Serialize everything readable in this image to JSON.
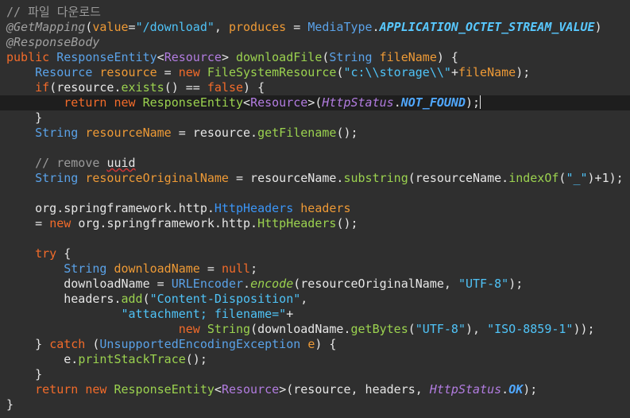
{
  "editor": {
    "lines": [
      [
        {
          "t": "// 파일 다운로드",
          "c": "cm"
        }
      ],
      [
        {
          "t": "@GetMapping",
          "c": "an"
        },
        {
          "t": "(",
          "c": "pl"
        },
        {
          "t": "value",
          "c": "pr"
        },
        {
          "t": "=",
          "c": "pl"
        },
        {
          "t": "\"/download\"",
          "c": "st"
        },
        {
          "t": ", ",
          "c": "pl"
        },
        {
          "t": "produces",
          "c": "pr"
        },
        {
          "t": " = ",
          "c": "pl"
        },
        {
          "t": "MediaType",
          "c": "ty"
        },
        {
          "t": ".",
          "c": "pl"
        },
        {
          "t": "APPLICATION_OCTET_STREAM_VALUE",
          "c": "cb"
        },
        {
          "t": ")",
          "c": "pl"
        }
      ],
      [
        {
          "t": "@ResponseBody",
          "c": "an"
        }
      ],
      [
        {
          "t": "public ",
          "c": "kw"
        },
        {
          "t": "ResponseEntity",
          "c": "ty"
        },
        {
          "t": "<",
          "c": "pl"
        },
        {
          "t": "Resource",
          "c": "ge"
        },
        {
          "t": "> ",
          "c": "pl"
        },
        {
          "t": "downloadFile",
          "c": "mt"
        },
        {
          "t": "(",
          "c": "pl"
        },
        {
          "t": "String ",
          "c": "ty"
        },
        {
          "t": "fileName",
          "c": "pr"
        },
        {
          "t": ") {",
          "c": "pl"
        }
      ],
      [
        {
          "t": "    ",
          "c": "pl"
        },
        {
          "t": "Resource ",
          "c": "ty"
        },
        {
          "t": "resource",
          "c": "pr"
        },
        {
          "t": " = ",
          "c": "pl"
        },
        {
          "t": "new ",
          "c": "kw"
        },
        {
          "t": "FileSystemResource",
          "c": "gn"
        },
        {
          "t": "(",
          "c": "pl"
        },
        {
          "t": "\"c:\\\\storage\\\\\"",
          "c": "st"
        },
        {
          "t": "+",
          "c": "pl"
        },
        {
          "t": "fileName",
          "c": "pr"
        },
        {
          "t": ");",
          "c": "pl"
        }
      ],
      [
        {
          "t": "    ",
          "c": "pl"
        },
        {
          "t": "if",
          "c": "kw"
        },
        {
          "t": "(resource.",
          "c": "pl"
        },
        {
          "t": "exists",
          "c": "mt"
        },
        {
          "t": "() == ",
          "c": "pl"
        },
        {
          "t": "false",
          "c": "kw"
        },
        {
          "t": ") {",
          "c": "pl"
        }
      ],
      [
        {
          "t": "        ",
          "c": "pl"
        },
        {
          "t": "return ",
          "c": "kw"
        },
        {
          "t": "new ",
          "c": "kw"
        },
        {
          "t": "ResponseEntity",
          "c": "gn"
        },
        {
          "t": "<",
          "c": "pl"
        },
        {
          "t": "Resource",
          "c": "ge"
        },
        {
          "t": ">(",
          "c": "pl"
        },
        {
          "t": "HttpStatus",
          "c": "ic"
        },
        {
          "t": ".",
          "c": "pl"
        },
        {
          "t": "NOT_FOUND",
          "c": "cn"
        },
        {
          "t": ");",
          "c": "pl"
        }
      ],
      [
        {
          "t": "    }",
          "c": "pl"
        }
      ],
      [
        {
          "t": "    ",
          "c": "pl"
        },
        {
          "t": "String ",
          "c": "ty"
        },
        {
          "t": "resourceName",
          "c": "pr"
        },
        {
          "t": " = resource.",
          "c": "pl"
        },
        {
          "t": "getFilename",
          "c": "mt"
        },
        {
          "t": "();",
          "c": "pl"
        }
      ],
      [],
      [
        {
          "t": "    // remove ",
          "c": "cm"
        },
        {
          "t": "uuid",
          "c": "sq"
        }
      ],
      [
        {
          "t": "    ",
          "c": "pl"
        },
        {
          "t": "String ",
          "c": "ty"
        },
        {
          "t": "resourceOriginalName",
          "c": "pr"
        },
        {
          "t": " = resourceName.",
          "c": "pl"
        },
        {
          "t": "substring",
          "c": "mt"
        },
        {
          "t": "(resourceName.",
          "c": "pl"
        },
        {
          "t": "indexOf",
          "c": "mt"
        },
        {
          "t": "(",
          "c": "pl"
        },
        {
          "t": "\"_\"",
          "c": "st"
        },
        {
          "t": ")+1);",
          "c": "pl"
        }
      ],
      [],
      [
        {
          "t": "    org.springframework.http.",
          "c": "pl"
        },
        {
          "t": "HttpHeaders ",
          "c": "tb"
        },
        {
          "t": "headers",
          "c": "pr"
        }
      ],
      [
        {
          "t": "    = ",
          "c": "pl"
        },
        {
          "t": "new ",
          "c": "kw"
        },
        {
          "t": "org.springframework.http.",
          "c": "pl"
        },
        {
          "t": "HttpHeaders",
          "c": "gn"
        },
        {
          "t": "();",
          "c": "pl"
        }
      ],
      [],
      [
        {
          "t": "    ",
          "c": "pl"
        },
        {
          "t": "try",
          "c": "kw"
        },
        {
          "t": " {",
          "c": "pl"
        }
      ],
      [
        {
          "t": "        ",
          "c": "pl"
        },
        {
          "t": "String ",
          "c": "ty"
        },
        {
          "t": "downloadName",
          "c": "pr"
        },
        {
          "t": " = ",
          "c": "pl"
        },
        {
          "t": "null",
          "c": "kw"
        },
        {
          "t": ";",
          "c": "pl"
        }
      ],
      [
        {
          "t": "        downloadName = ",
          "c": "pl"
        },
        {
          "t": "URLEncoder",
          "c": "ty"
        },
        {
          "t": ".",
          "c": "pl"
        },
        {
          "t": "encode",
          "c": "mi"
        },
        {
          "t": "(resourceOriginalName, ",
          "c": "pl"
        },
        {
          "t": "\"UTF-8\"",
          "c": "st"
        },
        {
          "t": ");",
          "c": "pl"
        }
      ],
      [
        {
          "t": "        headers.",
          "c": "pl"
        },
        {
          "t": "add",
          "c": "mt"
        },
        {
          "t": "(",
          "c": "pl"
        },
        {
          "t": "\"Content-Disposition\"",
          "c": "st"
        },
        {
          "t": ",",
          "c": "pl"
        }
      ],
      [
        {
          "t": "                ",
          "c": "pl"
        },
        {
          "t": "\"attachment; filename=\"",
          "c": "st"
        },
        {
          "t": "+",
          "c": "pl"
        }
      ],
      [
        {
          "t": "                        ",
          "c": "pl"
        },
        {
          "t": "new ",
          "c": "kw"
        },
        {
          "t": "String",
          "c": "gn"
        },
        {
          "t": "(downloadName.",
          "c": "pl"
        },
        {
          "t": "getBytes",
          "c": "mt"
        },
        {
          "t": "(",
          "c": "pl"
        },
        {
          "t": "\"UTF-8\"",
          "c": "st"
        },
        {
          "t": "), ",
          "c": "pl"
        },
        {
          "t": "\"ISO-8859-1\"",
          "c": "st"
        },
        {
          "t": "));",
          "c": "pl"
        }
      ],
      [
        {
          "t": "    } ",
          "c": "pl"
        },
        {
          "t": "catch ",
          "c": "kw"
        },
        {
          "t": "(",
          "c": "pl"
        },
        {
          "t": "UnsupportedEncodingException ",
          "c": "ty"
        },
        {
          "t": "e",
          "c": "pr"
        },
        {
          "t": ") {",
          "c": "pl"
        }
      ],
      [
        {
          "t": "        e.",
          "c": "pl"
        },
        {
          "t": "printStackTrace",
          "c": "mt"
        },
        {
          "t": "();",
          "c": "pl"
        }
      ],
      [
        {
          "t": "    }",
          "c": "pl"
        }
      ],
      [
        {
          "t": "    ",
          "c": "pl"
        },
        {
          "t": "return ",
          "c": "kw"
        },
        {
          "t": "new ",
          "c": "kw"
        },
        {
          "t": "ResponseEntity",
          "c": "gn"
        },
        {
          "t": "<",
          "c": "pl"
        },
        {
          "t": "Resource",
          "c": "ge"
        },
        {
          "t": ">(resource, headers, ",
          "c": "pl"
        },
        {
          "t": "HttpStatus",
          "c": "ic"
        },
        {
          "t": ".",
          "c": "pl"
        },
        {
          "t": "OK",
          "c": "cn"
        },
        {
          "t": ");",
          "c": "pl"
        }
      ],
      [
        {
          "t": "}",
          "c": "pl"
        }
      ]
    ],
    "current_line_index": 6,
    "colors": {
      "background": "#2f2f2f",
      "current_line": "#1e1e1e",
      "keyword": "#f26b2a",
      "string": "#4fc3f7",
      "comment": "#9a9a9a",
      "type": "#5aa2e8"
    }
  }
}
